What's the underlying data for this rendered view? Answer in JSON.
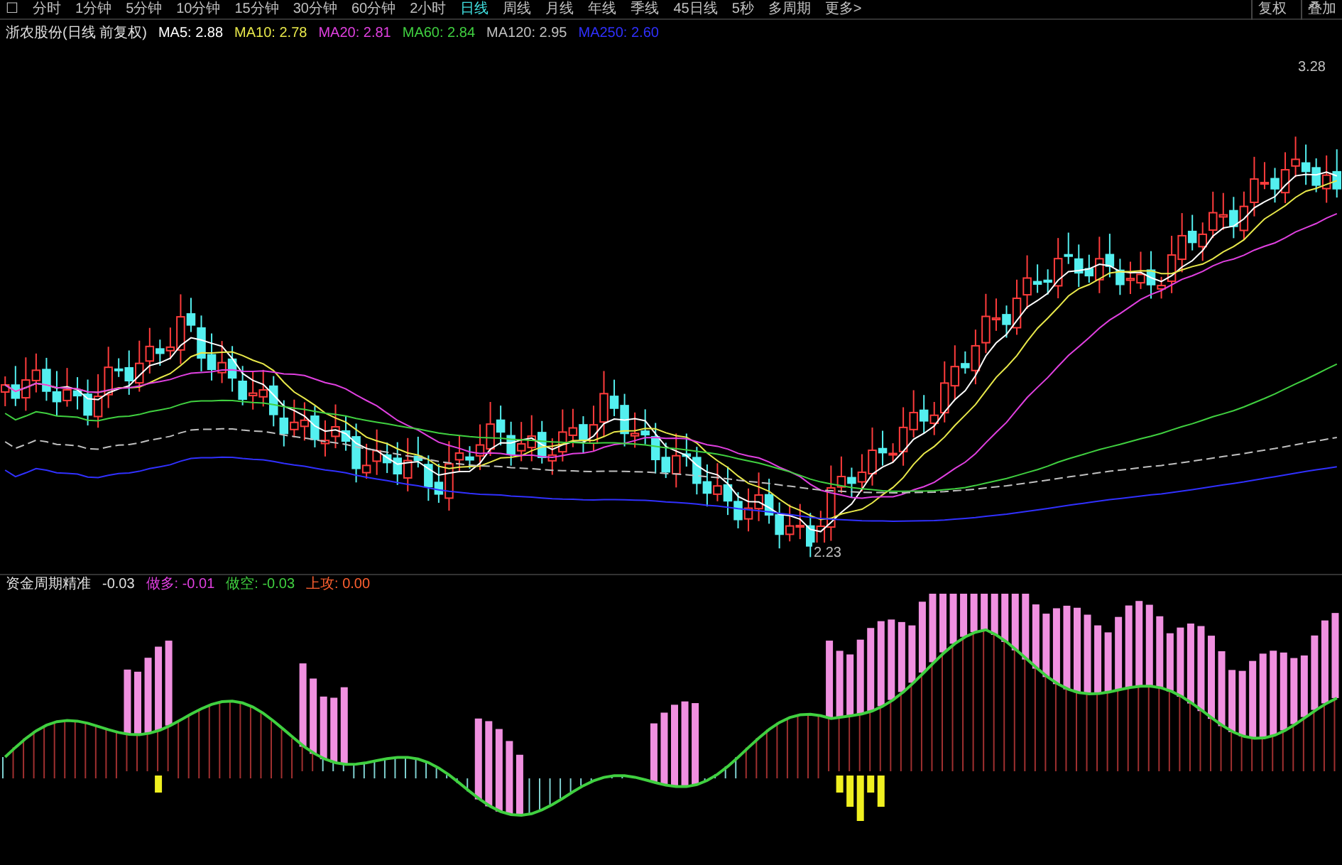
{
  "toolbar": {
    "items": [
      {
        "label": "☐",
        "selected": false
      },
      {
        "label": "分时",
        "selected": false
      },
      {
        "label": "1分钟",
        "selected": false
      },
      {
        "label": "5分钟",
        "selected": false
      },
      {
        "label": "10分钟",
        "selected": false
      },
      {
        "label": "15分钟",
        "selected": false
      },
      {
        "label": "30分钟",
        "selected": false
      },
      {
        "label": "60分钟",
        "selected": false
      },
      {
        "label": "2小时",
        "selected": false
      },
      {
        "label": "日线",
        "selected": true
      },
      {
        "label": "周线",
        "selected": false
      },
      {
        "label": "月线",
        "selected": false
      },
      {
        "label": "年线",
        "selected": false
      },
      {
        "label": "季线",
        "selected": false
      },
      {
        "label": "45日线",
        "selected": false
      },
      {
        "label": "5秒",
        "selected": false
      },
      {
        "label": "多周期",
        "selected": false
      },
      {
        "label": "更多>",
        "selected": false
      }
    ],
    "right_buttons": [
      "复权",
      "叠加"
    ]
  },
  "main_legend": {
    "title": "浙农股份(日线 前复权)",
    "items": [
      {
        "label": "MA5: 2.88",
        "color": "#ffffff"
      },
      {
        "label": "MA10: 2.78",
        "color": "#e8e84a"
      },
      {
        "label": "MA20: 2.81",
        "color": "#e040e0"
      },
      {
        "label": "MA60: 2.84",
        "color": "#40d040"
      },
      {
        "label": "MA120: 2.95",
        "color": "#c0c0c0"
      },
      {
        "label": "MA250: 2.60",
        "color": "#3030ff"
      }
    ]
  },
  "price_labels": {
    "high": "3.28",
    "low": "2.23"
  },
  "indicator_legend": {
    "title": "资金周期精准",
    "value": "-0.03",
    "items": [
      {
        "label": "做多: -0.01",
        "color": "#e040e0"
      },
      {
        "label": "做空: -0.03",
        "color": "#40d040"
      },
      {
        "label": "上攻: 0.00",
        "color": "#ff6030"
      }
    ]
  }
}
